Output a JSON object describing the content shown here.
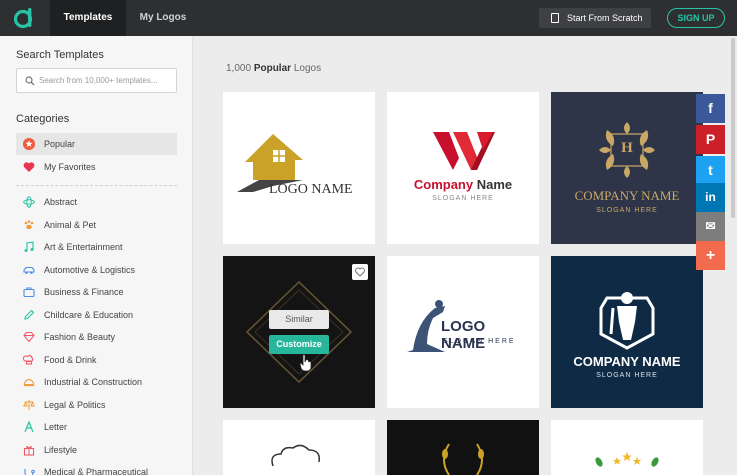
{
  "app": {
    "brand_color": "#27c4a5"
  },
  "topnav": {
    "tabs": [
      {
        "label": "Templates",
        "active": true
      },
      {
        "label": "My Logos",
        "active": false
      }
    ],
    "start_from_scratch": "Start From Scratch",
    "signup": "SIGN UP"
  },
  "sidebar": {
    "search_title": "Search Templates",
    "search_placeholder": "Search from 10,000+ templates...",
    "categories_title": "Categories",
    "pinned": [
      {
        "label": "Popular",
        "icon": "star-badge-icon",
        "active": true
      },
      {
        "label": "My Favorites",
        "icon": "heart-icon",
        "active": false
      }
    ],
    "categories": [
      {
        "label": "Abstract",
        "icon": "abstract-icon"
      },
      {
        "label": "Animal & Pet",
        "icon": "paw-icon"
      },
      {
        "label": "Art & Entertainment",
        "icon": "music-note-icon"
      },
      {
        "label": "Automotive & Logistics",
        "icon": "car-icon"
      },
      {
        "label": "Business & Finance",
        "icon": "briefcase-icon"
      },
      {
        "label": "Childcare & Education",
        "icon": "pencil-icon"
      },
      {
        "label": "Fashion & Beauty",
        "icon": "diamond-icon"
      },
      {
        "label": "Food & Drink",
        "icon": "chef-hat-icon"
      },
      {
        "label": "Industrial & Construction",
        "icon": "helmet-icon"
      },
      {
        "label": "Legal & Politics",
        "icon": "scale-icon"
      },
      {
        "label": "Letter",
        "icon": "letter-a-icon"
      },
      {
        "label": "Lifestyle",
        "icon": "gift-icon"
      },
      {
        "label": "Medical & Pharmaceutical",
        "icon": "medical-icon"
      }
    ]
  },
  "main": {
    "count_number": "1,000",
    "count_bold": "Popular",
    "count_suffix": "Logos"
  },
  "cards": {
    "house": {
      "text": "LOGO NAME"
    },
    "w_logo": {
      "company": "Company",
      "name": "Name",
      "slogan": "SLOGAN HERE"
    },
    "h_logo": {
      "letter": "H",
      "company": "COMPANY NAME",
      "slogan": "SLOGAN HERE"
    },
    "hover": {
      "similar": "Similar",
      "customize": "Customize"
    },
    "yoga": {
      "name": "LOGO NAME",
      "slogan": "SLOGAN HERE"
    },
    "knight": {
      "company": "COMPANY NAME",
      "slogan": "SLOGAN HERE"
    }
  },
  "social": [
    {
      "name": "facebook",
      "glyph": "f",
      "color": "#3b5998"
    },
    {
      "name": "pinterest",
      "glyph": "P",
      "color": "#cb2027"
    },
    {
      "name": "twitter",
      "glyph": "t",
      "color": "#1da1f2"
    },
    {
      "name": "linkedin",
      "glyph": "in",
      "color": "#0077b5"
    },
    {
      "name": "email",
      "glyph": "✉",
      "color": "#7d7d7d"
    },
    {
      "name": "share-more",
      "glyph": "+",
      "color": "#f26b4f"
    }
  ]
}
